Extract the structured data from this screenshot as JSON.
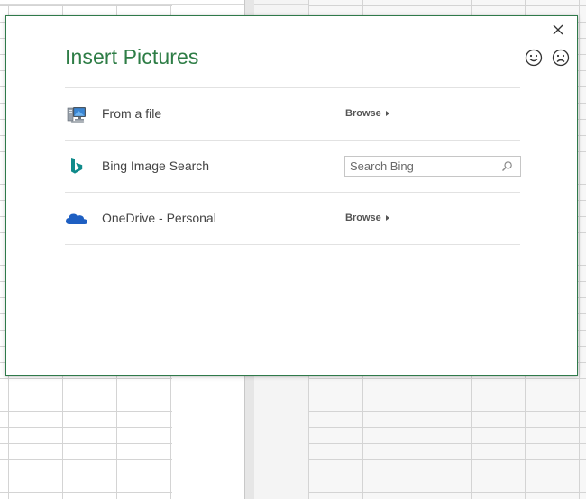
{
  "dialog": {
    "title": "Insert Pictures",
    "close_icon": "close-icon",
    "feedback": {
      "smile_icon": "smiley-face-icon",
      "frown_icon": "frowning-face-icon"
    },
    "accent_color": "#2e7d46"
  },
  "sources": [
    {
      "label": "From a file",
      "icon": "computer-icon",
      "action_label": "Browse"
    },
    {
      "label": "Bing Image Search",
      "icon": "bing-icon",
      "search_placeholder": "Search Bing",
      "search_value": ""
    },
    {
      "label": "OneDrive - Personal",
      "icon": "onedrive-cloud-icon",
      "action_label": "Browse"
    }
  ]
}
